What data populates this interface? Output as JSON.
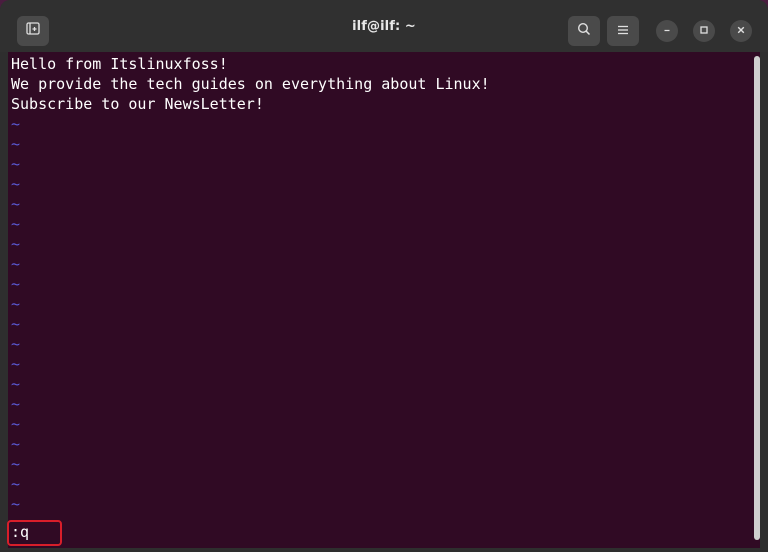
{
  "window": {
    "title": "ilf@ilf: ~"
  },
  "icons": {
    "new_tab": "new-tab-icon",
    "search": "search-icon",
    "menu": "hamburger-menu-icon",
    "minimize": "minimize-icon",
    "maximize": "maximize-icon",
    "close": "close-icon"
  },
  "terminal": {
    "lines": [
      "Hello from Itslinuxfoss!",
      "We provide the tech guides on everything about Linux!",
      "Subscribe to our NewsLetter!"
    ],
    "tilde": "~",
    "command": ":q"
  },
  "colors": {
    "terminal_bg": "#300a24",
    "text": "#ffffff",
    "tilde": "#5b5bd6",
    "highlight": "#d81e2a"
  }
}
